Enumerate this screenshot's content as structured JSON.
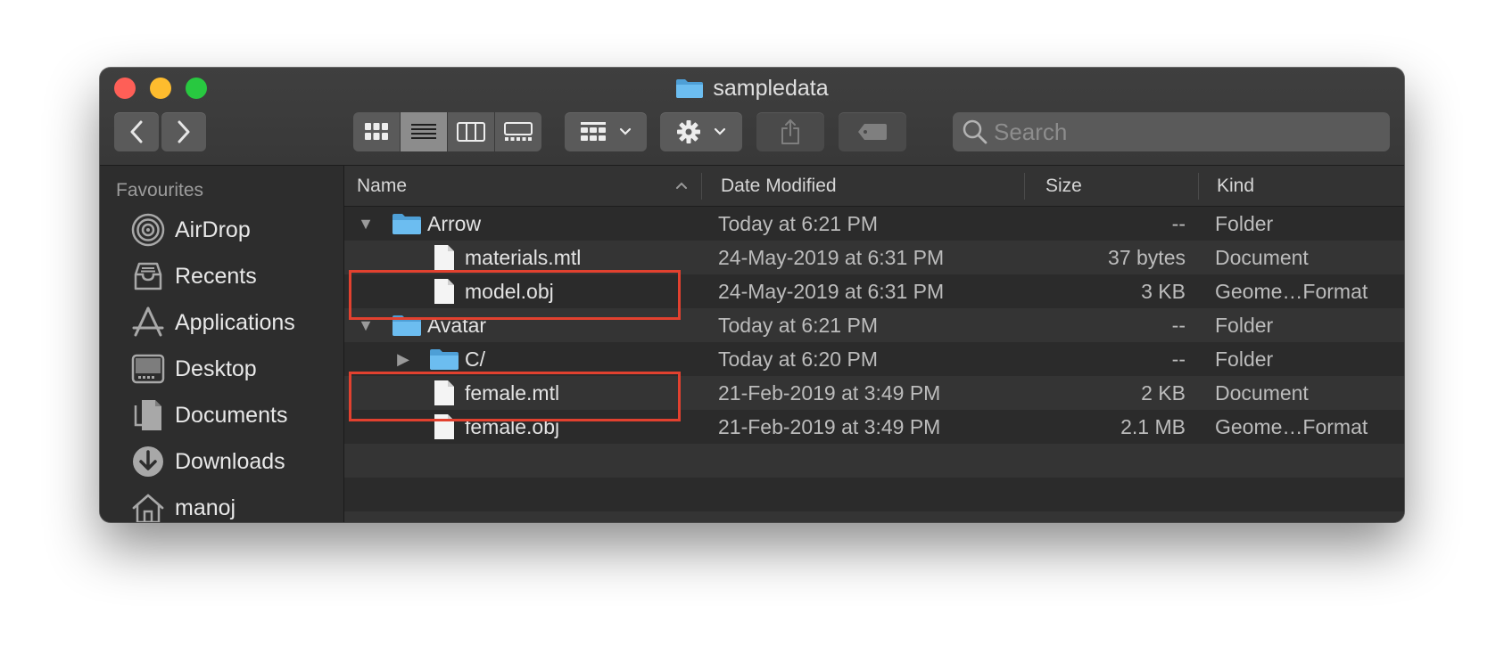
{
  "window": {
    "title": "sampledata"
  },
  "toolbar": {
    "search_placeholder": "Search"
  },
  "sidebar": {
    "section": "Favourites",
    "items": [
      {
        "label": "AirDrop",
        "icon": "airdrop-icon"
      },
      {
        "label": "Recents",
        "icon": "recents-icon"
      },
      {
        "label": "Applications",
        "icon": "applications-icon"
      },
      {
        "label": "Desktop",
        "icon": "desktop-icon"
      },
      {
        "label": "Documents",
        "icon": "documents-icon"
      },
      {
        "label": "Downloads",
        "icon": "downloads-icon"
      },
      {
        "label": "manoj",
        "icon": "home-icon"
      }
    ]
  },
  "columns": {
    "name": "Name",
    "date": "Date Modified",
    "size": "Size",
    "kind": "Kind"
  },
  "files": [
    {
      "name": "Arrow",
      "date": "Today at 6:21 PM",
      "size": "--",
      "kind": "Folder",
      "type": "folder",
      "level": 0,
      "disclosure": "expanded"
    },
    {
      "name": "materials.mtl",
      "date": "24-May-2019 at 6:31 PM",
      "size": "37 bytes",
      "kind": "Document",
      "type": "file",
      "level": 1,
      "disclosure": "none"
    },
    {
      "name": "model.obj",
      "date": "24-May-2019 at 6:31 PM",
      "size": "3 KB",
      "kind": "Geome…Format",
      "type": "file",
      "level": 1,
      "disclosure": "none"
    },
    {
      "name": "Avatar",
      "date": "Today at 6:21 PM",
      "size": "--",
      "kind": "Folder",
      "type": "folder",
      "level": 0,
      "disclosure": "expanded"
    },
    {
      "name": "C/",
      "date": "Today at 6:20 PM",
      "size": "--",
      "kind": "Folder",
      "type": "folder",
      "level": 1,
      "disclosure": "collapsed"
    },
    {
      "name": "female.mtl",
      "date": "21-Feb-2019 at 3:49 PM",
      "size": "2 KB",
      "kind": "Document",
      "type": "file",
      "level": 1,
      "disclosure": "none"
    },
    {
      "name": "female.obj",
      "date": "21-Feb-2019 at 3:49 PM",
      "size": "2.1 MB",
      "kind": "Geome…Format",
      "type": "file",
      "level": 1,
      "disclosure": "none"
    }
  ],
  "colors": {
    "highlight": "#e2412f",
    "folder": "#5fb3e8",
    "close": "#fe5f57",
    "minimize": "#febc2e",
    "zoom": "#28c840"
  }
}
